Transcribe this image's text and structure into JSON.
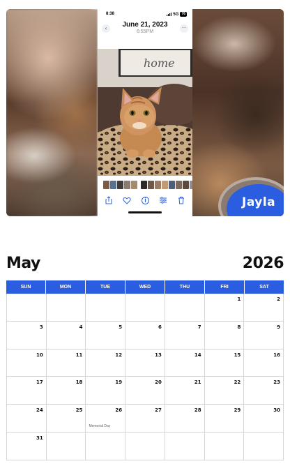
{
  "photo": {
    "status_time": "8:38",
    "status_signal": "5G",
    "status_battery": "76",
    "date": "June 21, 2023",
    "time": "6:55PM",
    "sign_text": "home",
    "toolbar_icons": [
      "share-icon",
      "heart-icon",
      "info-icon",
      "adjust-icon",
      "trash-icon"
    ],
    "thumb_colors": [
      "#7a5a48",
      "#5b6f8e",
      "#3f3b3a",
      "#8a7c70",
      "#a48a6e",
      "#2f2a28",
      "#6e5a4a",
      "#9a7e6a",
      "#c29a74",
      "#4f5f7a",
      "#7d6a5e",
      "#5a4a40",
      "#8f8e96",
      "#6a4e3e"
    ]
  },
  "badge": {
    "name": "Jayla"
  },
  "calendar": {
    "month": "May",
    "year": "2026",
    "weekdays": [
      "SUN",
      "MON",
      "TUE",
      "WED",
      "THU",
      "FRI",
      "SAT"
    ],
    "weeks": [
      [
        "",
        "",
        "",
        "",
        "",
        "1",
        "2"
      ],
      [
        "3",
        "4",
        "5",
        "6",
        "7",
        "8",
        "9"
      ],
      [
        "10",
        "11",
        "12",
        "13",
        "14",
        "15",
        "16"
      ],
      [
        "17",
        "18",
        "19",
        "20",
        "21",
        "22",
        "23"
      ],
      [
        "24",
        "25",
        "26",
        "27",
        "28",
        "29",
        "30"
      ],
      [
        "31",
        "",
        "",
        "",
        "",
        "",
        ""
      ]
    ],
    "note": "Memorial Day",
    "accent_color": "#2a5de0"
  }
}
